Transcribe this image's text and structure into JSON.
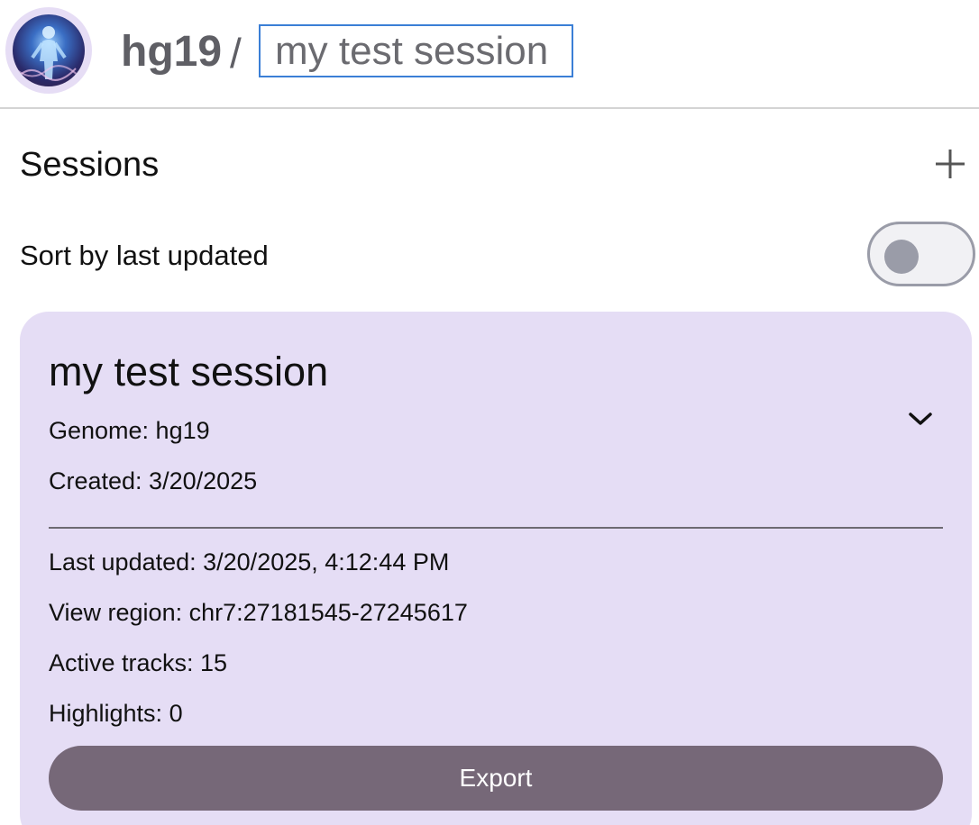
{
  "header": {
    "genome": "hg19",
    "separator": "/",
    "session_name_value": "my test session",
    "avatar_icon": "human-dna-avatar"
  },
  "sessions": {
    "title": "Sessions",
    "add_icon": "plus-icon",
    "sort_label": "Sort by last updated",
    "sort_toggle_on": false
  },
  "session_card": {
    "title": "my test session",
    "genome": "Genome: hg19",
    "created": "Created: 3/20/2025",
    "last_updated": "Last updated: 3/20/2025, 4:12:44 PM",
    "view_region": "View region: chr7:27181545-27245617",
    "active_tracks": "Active tracks: 15",
    "highlights": "Highlights: 0",
    "export_label": "Export",
    "expand_icon": "chevron-down-icon"
  },
  "colors": {
    "card_background": "#e5ddf5",
    "export_button": "#766878",
    "input_border": "#3b7fd6",
    "toggle_knob": "#9a9ca8"
  }
}
